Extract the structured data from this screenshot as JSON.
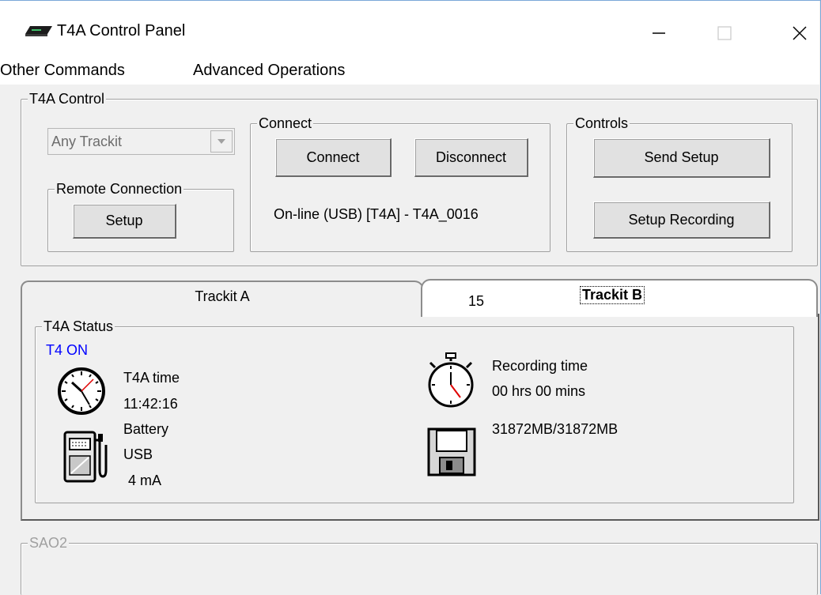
{
  "window": {
    "title": "T4A Control Panel",
    "controls": [
      "minimize-icon",
      "maximize-icon",
      "close-icon"
    ]
  },
  "menu": {
    "items": [
      "Other Commands",
      "Advanced Operations"
    ]
  },
  "t4a_control": {
    "label": "T4A Control",
    "trackit_select": {
      "value": "Any Trackit"
    },
    "remote_connection": {
      "label": "Remote Connection",
      "setup_button": "Setup"
    },
    "connect": {
      "label": "Connect",
      "connect_button": "Connect",
      "disconnect_button": "Disconnect",
      "status": "On-line (USB) [T4A] - T4A_0016"
    },
    "controls": {
      "label": "Controls",
      "send_setup_button": "Send Setup",
      "setup_recording_button": "Setup Recording"
    }
  },
  "tabs": {
    "tab_a": "Trackit A",
    "tab_b_number": "15",
    "tab_b": "Trackit B"
  },
  "status": {
    "label": "T4A Status",
    "power": "T4 ON",
    "time_label": "T4A time",
    "time_value": "11:42:16",
    "battery_label": "Battery",
    "battery_source": "USB",
    "battery_current": "4 mA",
    "recording_label": "Recording time",
    "recording_value": "00 hrs 00 mins",
    "storage": "31872MB/31872MB"
  },
  "sao2": {
    "label": "SAO2"
  },
  "colors": {
    "status_on": "#0000ff",
    "disabled": "#a0a0a0"
  }
}
